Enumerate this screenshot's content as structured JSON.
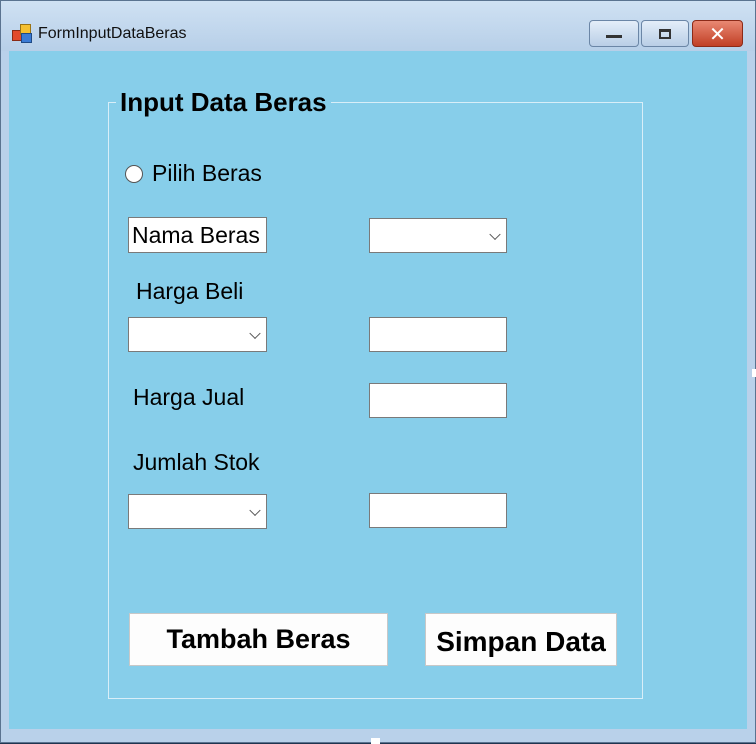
{
  "window": {
    "title": "FormInputDataBeras",
    "icon": "app-form-icon",
    "controls": {
      "minimize_icon": "minimize-icon",
      "maximize_icon": "maximize-icon",
      "close_icon": "close-icon",
      "close_glyph": "✕"
    },
    "client_color": "#87CEEA"
  },
  "form": {
    "group_title": "Input Data Beras",
    "radio": {
      "label": "Pilih Beras",
      "checked": false
    },
    "nama_beras_text": "Nama Beras",
    "nama_beras_combo_value": "",
    "harga_beli_label": "Harga Beli",
    "harga_beli_combo_value": "",
    "harga_beli_text_value": "",
    "harga_jual_label": "Harga Jual",
    "harga_jual_text_value": "",
    "jumlah_stok_label": "Jumlah Stok",
    "jumlah_stok_combo_value": "",
    "jumlah_stok_text_value": "",
    "buttons": {
      "tambah": "Tambah Beras",
      "simpan": "Simpan Data"
    }
  }
}
